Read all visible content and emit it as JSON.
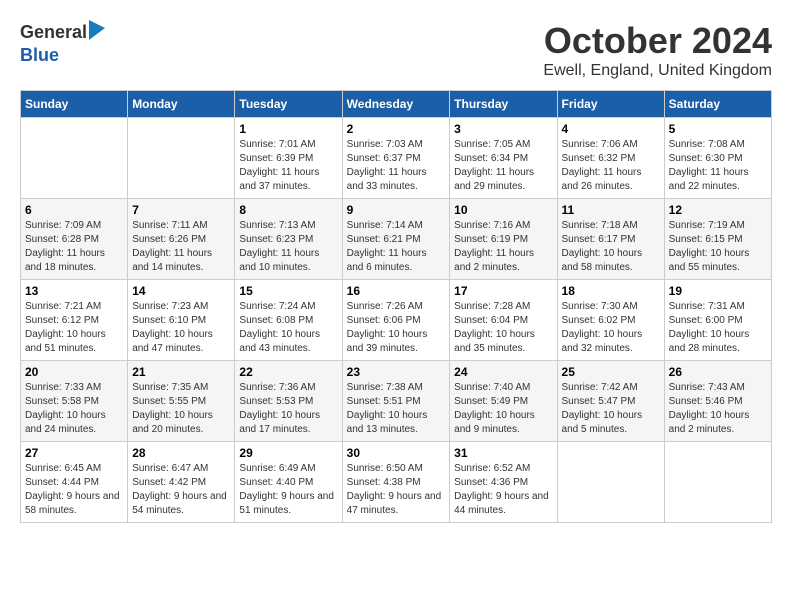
{
  "header": {
    "logo_general": "General",
    "logo_blue": "Blue",
    "month_title": "October 2024",
    "location": "Ewell, England, United Kingdom"
  },
  "days_of_week": [
    "Sunday",
    "Monday",
    "Tuesday",
    "Wednesday",
    "Thursday",
    "Friday",
    "Saturday"
  ],
  "weeks": [
    [
      {
        "day": "",
        "info": ""
      },
      {
        "day": "",
        "info": ""
      },
      {
        "day": "1",
        "info": "Sunrise: 7:01 AM\nSunset: 6:39 PM\nDaylight: 11 hours and 37 minutes."
      },
      {
        "day": "2",
        "info": "Sunrise: 7:03 AM\nSunset: 6:37 PM\nDaylight: 11 hours and 33 minutes."
      },
      {
        "day": "3",
        "info": "Sunrise: 7:05 AM\nSunset: 6:34 PM\nDaylight: 11 hours and 29 minutes."
      },
      {
        "day": "4",
        "info": "Sunrise: 7:06 AM\nSunset: 6:32 PM\nDaylight: 11 hours and 26 minutes."
      },
      {
        "day": "5",
        "info": "Sunrise: 7:08 AM\nSunset: 6:30 PM\nDaylight: 11 hours and 22 minutes."
      }
    ],
    [
      {
        "day": "6",
        "info": "Sunrise: 7:09 AM\nSunset: 6:28 PM\nDaylight: 11 hours and 18 minutes."
      },
      {
        "day": "7",
        "info": "Sunrise: 7:11 AM\nSunset: 6:26 PM\nDaylight: 11 hours and 14 minutes."
      },
      {
        "day": "8",
        "info": "Sunrise: 7:13 AM\nSunset: 6:23 PM\nDaylight: 11 hours and 10 minutes."
      },
      {
        "day": "9",
        "info": "Sunrise: 7:14 AM\nSunset: 6:21 PM\nDaylight: 11 hours and 6 minutes."
      },
      {
        "day": "10",
        "info": "Sunrise: 7:16 AM\nSunset: 6:19 PM\nDaylight: 11 hours and 2 minutes."
      },
      {
        "day": "11",
        "info": "Sunrise: 7:18 AM\nSunset: 6:17 PM\nDaylight: 10 hours and 58 minutes."
      },
      {
        "day": "12",
        "info": "Sunrise: 7:19 AM\nSunset: 6:15 PM\nDaylight: 10 hours and 55 minutes."
      }
    ],
    [
      {
        "day": "13",
        "info": "Sunrise: 7:21 AM\nSunset: 6:12 PM\nDaylight: 10 hours and 51 minutes."
      },
      {
        "day": "14",
        "info": "Sunrise: 7:23 AM\nSunset: 6:10 PM\nDaylight: 10 hours and 47 minutes."
      },
      {
        "day": "15",
        "info": "Sunrise: 7:24 AM\nSunset: 6:08 PM\nDaylight: 10 hours and 43 minutes."
      },
      {
        "day": "16",
        "info": "Sunrise: 7:26 AM\nSunset: 6:06 PM\nDaylight: 10 hours and 39 minutes."
      },
      {
        "day": "17",
        "info": "Sunrise: 7:28 AM\nSunset: 6:04 PM\nDaylight: 10 hours and 35 minutes."
      },
      {
        "day": "18",
        "info": "Sunrise: 7:30 AM\nSunset: 6:02 PM\nDaylight: 10 hours and 32 minutes."
      },
      {
        "day": "19",
        "info": "Sunrise: 7:31 AM\nSunset: 6:00 PM\nDaylight: 10 hours and 28 minutes."
      }
    ],
    [
      {
        "day": "20",
        "info": "Sunrise: 7:33 AM\nSunset: 5:58 PM\nDaylight: 10 hours and 24 minutes."
      },
      {
        "day": "21",
        "info": "Sunrise: 7:35 AM\nSunset: 5:55 PM\nDaylight: 10 hours and 20 minutes."
      },
      {
        "day": "22",
        "info": "Sunrise: 7:36 AM\nSunset: 5:53 PM\nDaylight: 10 hours and 17 minutes."
      },
      {
        "day": "23",
        "info": "Sunrise: 7:38 AM\nSunset: 5:51 PM\nDaylight: 10 hours and 13 minutes."
      },
      {
        "day": "24",
        "info": "Sunrise: 7:40 AM\nSunset: 5:49 PM\nDaylight: 10 hours and 9 minutes."
      },
      {
        "day": "25",
        "info": "Sunrise: 7:42 AM\nSunset: 5:47 PM\nDaylight: 10 hours and 5 minutes."
      },
      {
        "day": "26",
        "info": "Sunrise: 7:43 AM\nSunset: 5:46 PM\nDaylight: 10 hours and 2 minutes."
      }
    ],
    [
      {
        "day": "27",
        "info": "Sunrise: 6:45 AM\nSunset: 4:44 PM\nDaylight: 9 hours and 58 minutes."
      },
      {
        "day": "28",
        "info": "Sunrise: 6:47 AM\nSunset: 4:42 PM\nDaylight: 9 hours and 54 minutes."
      },
      {
        "day": "29",
        "info": "Sunrise: 6:49 AM\nSunset: 4:40 PM\nDaylight: 9 hours and 51 minutes."
      },
      {
        "day": "30",
        "info": "Sunrise: 6:50 AM\nSunset: 4:38 PM\nDaylight: 9 hours and 47 minutes."
      },
      {
        "day": "31",
        "info": "Sunrise: 6:52 AM\nSunset: 4:36 PM\nDaylight: 9 hours and 44 minutes."
      },
      {
        "day": "",
        "info": ""
      },
      {
        "day": "",
        "info": ""
      }
    ]
  ]
}
